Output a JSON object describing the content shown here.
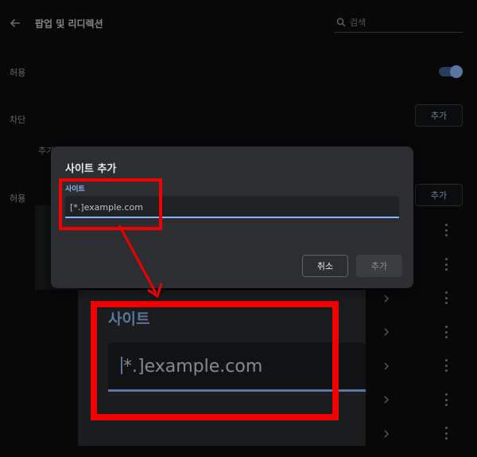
{
  "header": {
    "title": "팝업 및 리디렉션",
    "search_placeholder": "검색"
  },
  "settings": {
    "allow_label": "허용",
    "block_label": "차단",
    "block_add_label": "추가",
    "added_label": "추가",
    "allow_section_label": "허용",
    "allow_add_label": "추가",
    "allow_toggle_on": true
  },
  "dialog": {
    "title": "사이트 추가",
    "field_label": "사이트",
    "field_placeholder": "[*.]example.com",
    "cancel_label": "취소",
    "add_label": "추가"
  },
  "zoom": {
    "label": "사이트",
    "field_text": "*.]example.com"
  },
  "colors": {
    "accent": "#8ab4f8",
    "annotation": "#f00000",
    "dialog_bg": "#2d2e31",
    "page_bg": "#0d0d0e"
  }
}
